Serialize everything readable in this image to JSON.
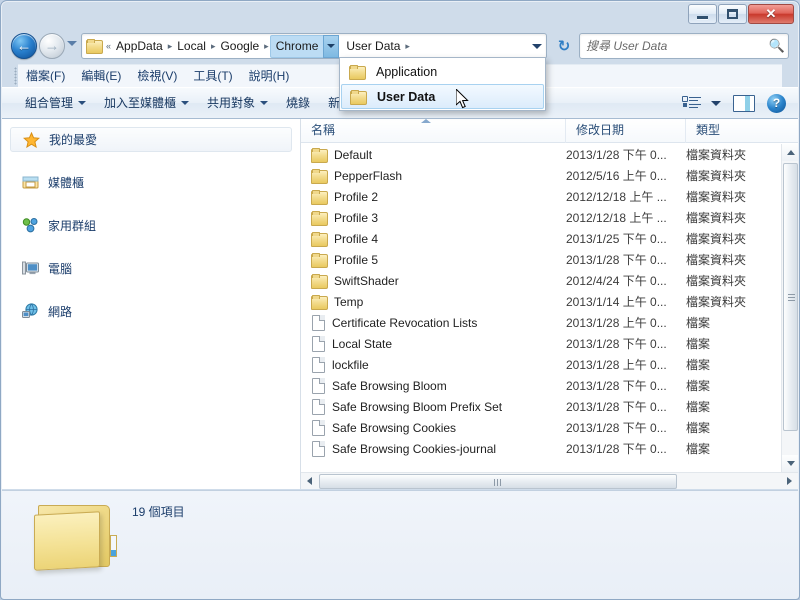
{
  "window": {
    "frame_color": "#cfdcea",
    "buttons": {
      "minimize": "minimize",
      "maximize": "maximize",
      "close": "✕"
    }
  },
  "navigation": {
    "back_label": "←",
    "forward_label": "→",
    "history_dropdown": "recent-pages",
    "refresh_label": "↻"
  },
  "address_bar": {
    "overflow_indicator": "«",
    "crumbs": [
      {
        "label": "AppData",
        "active": false
      },
      {
        "label": "Local",
        "active": false
      },
      {
        "label": "Google",
        "active": false
      },
      {
        "label": "Chrome",
        "active": true
      },
      {
        "label": "User Data",
        "active": false
      }
    ],
    "separator": "▸"
  },
  "crumb_menu": {
    "items": [
      {
        "label": "Application",
        "selected": false
      },
      {
        "label": "User Data",
        "selected": true
      }
    ]
  },
  "search": {
    "placeholder": "搜尋 User Data",
    "value": "",
    "icon": "search-icon"
  },
  "menubar": {
    "items": [
      "檔案(F)",
      "編輯(E)",
      "檢視(V)",
      "工具(T)",
      "說明(H)"
    ]
  },
  "command_bar": {
    "items": [
      {
        "label": "組合管理",
        "caret": true
      },
      {
        "label": "加入至媒體櫃",
        "caret": true
      },
      {
        "label": "共用對象",
        "caret": true
      },
      {
        "label": "燒錄",
        "caret": false
      },
      {
        "label": "新增資料夾",
        "caret": false
      }
    ],
    "right_icons": [
      "view-options-icon",
      "view-options-caret",
      "preview-pane-icon",
      "help-icon"
    ],
    "help_label": "?"
  },
  "sidebar": {
    "items": [
      {
        "label": "我的最愛",
        "icon": "star-icon",
        "highlighted": true
      },
      {
        "label": "媒體櫃",
        "icon": "library-icon",
        "highlighted": false
      },
      {
        "label": "家用群組",
        "icon": "homegroup-icon",
        "highlighted": false
      },
      {
        "label": "電腦",
        "icon": "computer-icon",
        "highlighted": false
      },
      {
        "label": "網路",
        "icon": "network-icon",
        "highlighted": false
      }
    ]
  },
  "file_list": {
    "columns": [
      "名稱",
      "修改日期",
      "類型"
    ],
    "sort_column": "名稱",
    "sort_direction": "ascending",
    "rows": [
      {
        "name": "Default",
        "date": "2013/1/28 下午 0...",
        "type": "檔案資料夾",
        "icon": "folder-icon"
      },
      {
        "name": "PepperFlash",
        "date": "2012/5/16 上午 0...",
        "type": "檔案資料夾",
        "icon": "folder-icon"
      },
      {
        "name": "Profile 2",
        "date": "2012/12/18 上午 ...",
        "type": "檔案資料夾",
        "icon": "folder-icon"
      },
      {
        "name": "Profile 3",
        "date": "2012/12/18 上午 ...",
        "type": "檔案資料夾",
        "icon": "folder-icon"
      },
      {
        "name": "Profile 4",
        "date": "2013/1/25 下午 0...",
        "type": "檔案資料夾",
        "icon": "folder-icon"
      },
      {
        "name": "Profile 5",
        "date": "2013/1/28 下午 0...",
        "type": "檔案資料夾",
        "icon": "folder-icon"
      },
      {
        "name": "SwiftShader",
        "date": "2012/4/24 下午 0...",
        "type": "檔案資料夾",
        "icon": "folder-icon"
      },
      {
        "name": "Temp",
        "date": "2013/1/14 上午 0...",
        "type": "檔案資料夾",
        "icon": "folder-icon"
      },
      {
        "name": "Certificate Revocation Lists",
        "date": "2013/1/28 上午 0...",
        "type": "檔案",
        "icon": "file-icon"
      },
      {
        "name": "Local State",
        "date": "2013/1/28 下午 0...",
        "type": "檔案",
        "icon": "file-icon"
      },
      {
        "name": "lockfile",
        "date": "2013/1/28 上午 0...",
        "type": "檔案",
        "icon": "file-icon"
      },
      {
        "name": "Safe Browsing Bloom",
        "date": "2013/1/28 下午 0...",
        "type": "檔案",
        "icon": "file-icon"
      },
      {
        "name": "Safe Browsing Bloom Prefix Set",
        "date": "2013/1/28 下午 0...",
        "type": "檔案",
        "icon": "file-icon"
      },
      {
        "name": "Safe Browsing Cookies",
        "date": "2013/1/28 下午 0...",
        "type": "檔案",
        "icon": "file-icon"
      },
      {
        "name": "Safe Browsing Cookies-journal",
        "date": "2013/1/28 下午 0...",
        "type": "檔案",
        "icon": "file-icon"
      }
    ]
  },
  "status_bar": {
    "item_count_text": "19 個項目",
    "icon": "large-folder-icon"
  }
}
